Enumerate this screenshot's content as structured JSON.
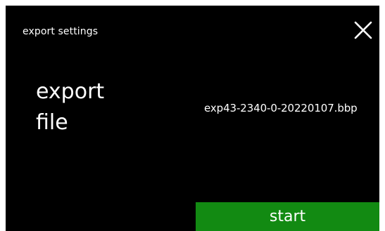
{
  "header": {
    "title": "export settings",
    "close_icon": "close-icon"
  },
  "main": {
    "label": "export\nfile",
    "file_name": "exp43-2340-0-20220107.bbp"
  },
  "footer": {
    "start_label": "start"
  },
  "colors": {
    "background": "#000000",
    "text": "#ffffff",
    "start_button": "#128a12"
  }
}
